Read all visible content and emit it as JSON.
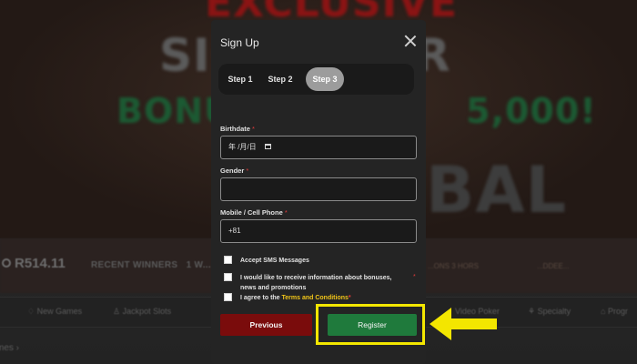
{
  "background": {
    "banner_lines": [
      "EXCLUSIVE",
      "SIG",
      "ER",
      "BONU",
      "5,000!",
      "BAL"
    ],
    "balance": "R514.11",
    "recent_winners_label": "RECENT WINNERS",
    "recent_winners_items": [
      "1 W...",
      "...ONS 3 HORS",
      "...DDEE...",
      "JOR..."
    ],
    "nav_items": [
      "New Games",
      "Jackpot Slots",
      "Video Poker",
      "Specialty",
      "Progr"
    ],
    "bottom_link": "mes"
  },
  "modal": {
    "title": "Sign Up",
    "steps": [
      "Step 1",
      "Step 2",
      "Step 3"
    ],
    "active_step": "Step 3",
    "birthdate": {
      "label": "Birthdate",
      "required_mark": "*",
      "placeholder": "年 /月/日"
    },
    "gender": {
      "label": "Gender",
      "required_mark": "*",
      "value": ""
    },
    "phone": {
      "label": "Mobile / Cell Phone",
      "required_mark": "*",
      "value": "+81"
    },
    "checkboxes": {
      "sms": {
        "label": "Accept SMS Messages",
        "checked": false
      },
      "promotions": {
        "label": "I would like to receive information about bonuses, news and promotions",
        "required_mark": "*",
        "checked": false
      },
      "terms": {
        "label_prefix": "I agree to the ",
        "link_text": "Terms and Conditions",
        "required_mark": "*",
        "checked": false
      }
    },
    "buttons": {
      "previous": "Previous",
      "register": "Register"
    }
  },
  "annotation": {
    "highlight_color": "#f3e600",
    "arrow_color": "#f3e600",
    "target": "register-button"
  },
  "colors": {
    "previous_button": "#7a0c0c",
    "register_button": "#1f7a3c",
    "active_step": "#9c9c9c",
    "required": "#e23b3b",
    "link": "#f0c419"
  }
}
